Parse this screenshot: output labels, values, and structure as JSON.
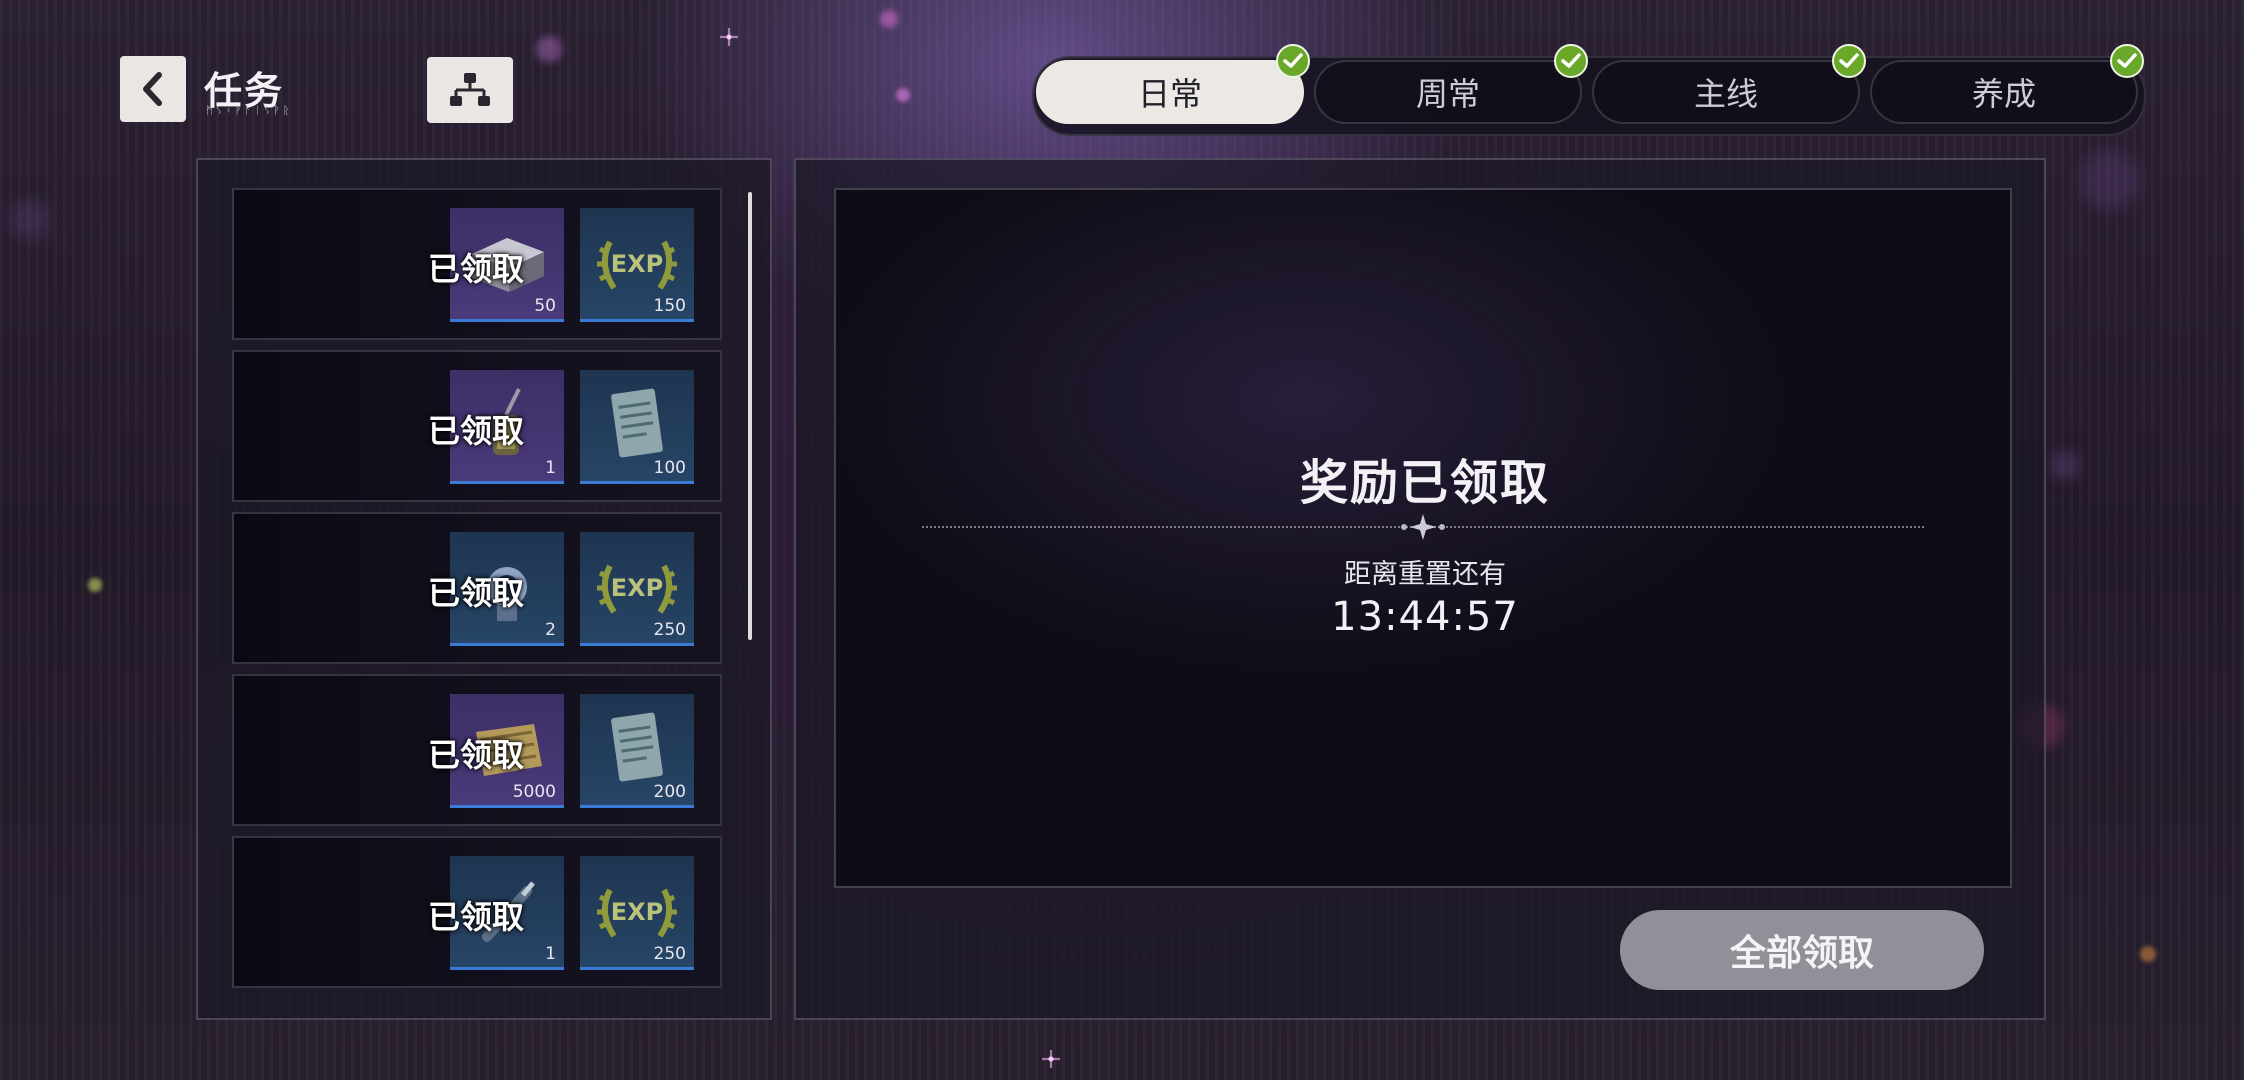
{
  "header": {
    "back_icon": "chevron-left-icon",
    "title": "任务",
    "subtitle": "ᛗᛊᚲᚹᚨᛁᛊᚹᚱ",
    "hierarchy_icon": "hierarchy-icon"
  },
  "tabs": [
    {
      "label": "日常",
      "active": true,
      "completed": true
    },
    {
      "label": "周常",
      "active": false,
      "completed": true
    },
    {
      "label": "主线",
      "active": false,
      "completed": true
    },
    {
      "label": "养成",
      "active": false,
      "completed": true
    }
  ],
  "tasks": [
    {
      "status": "已领取",
      "rewards": [
        {
          "icon": "metal-ingot-icon",
          "qty": "50",
          "rarity": "purple"
        },
        {
          "icon": "exp-laurel-icon",
          "label": "EXP",
          "qty": "150",
          "rarity": "blue"
        }
      ]
    },
    {
      "status": "已领取",
      "rewards": [
        {
          "icon": "lantern-icon",
          "qty": "1",
          "rarity": "purple"
        },
        {
          "icon": "clipboard-document-icon",
          "qty": "100",
          "rarity": "blue"
        }
      ]
    },
    {
      "status": "已领取",
      "rewards": [
        {
          "icon": "gear-part-icon",
          "qty": "2",
          "rarity": "blue"
        },
        {
          "icon": "exp-laurel-icon",
          "label": "EXP",
          "qty": "250",
          "rarity": "blue"
        }
      ]
    },
    {
      "status": "已领取",
      "rewards": [
        {
          "icon": "scroll-icon",
          "qty": "5000",
          "rarity": "purple"
        },
        {
          "icon": "clipboard-document-icon",
          "qty": "200",
          "rarity": "blue"
        }
      ]
    },
    {
      "status": "已领取",
      "rewards": [
        {
          "icon": "pen-icon",
          "qty": "1",
          "rarity": "blue"
        },
        {
          "icon": "exp-laurel-icon",
          "label": "EXP",
          "qty": "250",
          "rarity": "blue"
        }
      ]
    }
  ],
  "detail": {
    "title": "奖励已领取",
    "reset_label": "距离重置还有",
    "countdown": "13:44:57"
  },
  "claim_all_label": "全部领取",
  "colors": {
    "check": "#6aa82a",
    "active_tab": "#ece9e4",
    "rarity_purple": "#4a3a7a",
    "rarity_blue": "#274566"
  }
}
